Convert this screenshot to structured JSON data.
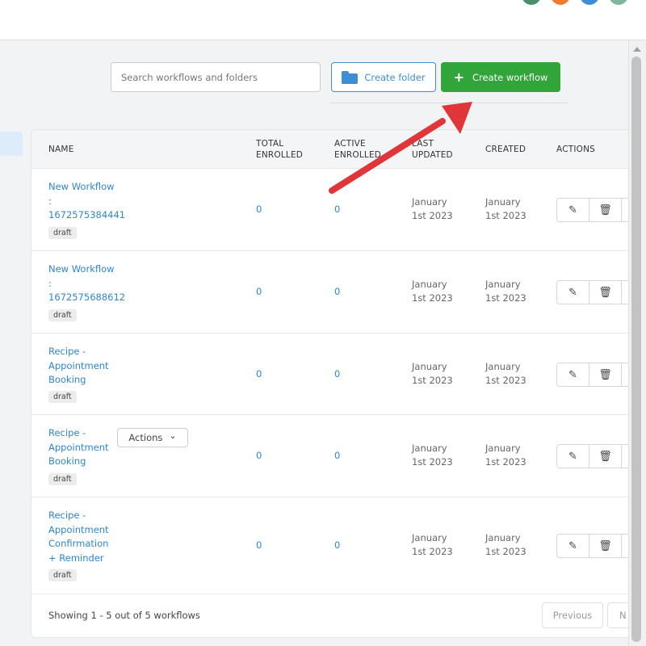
{
  "search": {
    "placeholder": "Search workflows and folders"
  },
  "toolbar": {
    "create_folder_label": "Create folder",
    "create_workflow_label": "Create workflow",
    "plus": "+"
  },
  "table": {
    "headers": {
      "name": "NAME",
      "total_enrolled": "TOTAL ENROLLED",
      "active_enrolled": "ACTIVE ENROLLED",
      "last_updated": "LAST UPDATED",
      "created": "CREATED",
      "actions": "ACTIONS"
    },
    "rows": [
      {
        "name_lines": [
          "New Workflow",
          ":",
          "1672575384441"
        ],
        "status": "draft",
        "total": "0",
        "active": "0",
        "updated": [
          "January",
          "1st 2023"
        ],
        "created": [
          "January",
          "1st 2023"
        ]
      },
      {
        "name_lines": [
          "New Workflow",
          ":",
          "1672575688612"
        ],
        "status": "draft",
        "total": "0",
        "active": "0",
        "updated": [
          "January",
          "1st 2023"
        ],
        "created": [
          "January",
          "1st 2023"
        ]
      },
      {
        "name_lines": [
          "Recipe -",
          "Appointment",
          "Booking"
        ],
        "status": "draft",
        "total": "0",
        "active": "0",
        "updated": [
          "January",
          "1st 2023"
        ],
        "created": [
          "January",
          "1st 2023"
        ]
      },
      {
        "name_lines": [
          "Recipe -",
          "Appointment",
          "Booking"
        ],
        "status": "draft",
        "total": "0",
        "active": "0",
        "updated": [
          "January",
          "1st 2023"
        ],
        "created": [
          "January",
          "1st 2023"
        ],
        "actions_dropdown": "Actions"
      },
      {
        "name_lines": [
          "Recipe -",
          "Appointment",
          "Confirmation",
          "+ Reminder"
        ],
        "status": "draft",
        "total": "0",
        "active": "0",
        "updated": [
          "January",
          "1st 2023"
        ],
        "created": [
          "January",
          "1st 2023"
        ]
      }
    ]
  },
  "footer": {
    "showing": "Showing 1 - 5 out of 5 workflows",
    "previous": "Previous",
    "next": "N"
  },
  "icons": {
    "edit": "✎",
    "delete": "🗑",
    "chevron": "⌄"
  },
  "colors": {
    "primary_blue": "#2e86d1",
    "create_green": "#31a43a",
    "annotation_red": "#e0363a"
  }
}
